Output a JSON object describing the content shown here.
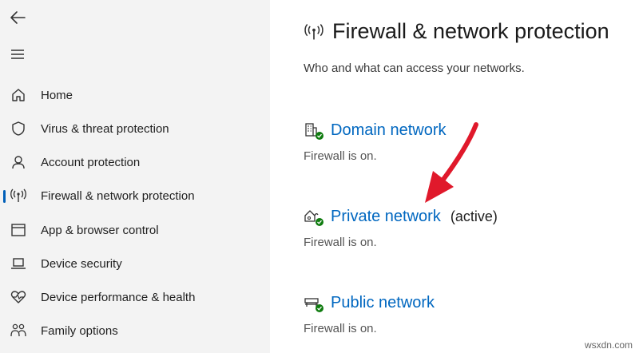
{
  "sidebar": {
    "back_icon": "back-arrow-icon",
    "menu_icon": "hamburger-menu-icon",
    "items": [
      {
        "label": "Home",
        "icon": "home-icon"
      },
      {
        "label": "Virus & threat protection",
        "icon": "shield-icon"
      },
      {
        "label": "Account protection",
        "icon": "person-icon"
      },
      {
        "label": "Firewall & network protection",
        "icon": "antenna-icon",
        "active": true
      },
      {
        "label": "App & browser control",
        "icon": "browser-window-icon"
      },
      {
        "label": "Device security",
        "icon": "laptop-icon"
      },
      {
        "label": "Device performance & health",
        "icon": "heart-pulse-icon"
      },
      {
        "label": "Family options",
        "icon": "family-icon"
      }
    ]
  },
  "main": {
    "title": "Firewall & network protection",
    "subtitle": "Who and what can access your networks.",
    "networks": [
      {
        "name": "Domain network",
        "extra": "",
        "status": "Firewall is on.",
        "icon": "building-icon"
      },
      {
        "name": "Private network",
        "extra": "(active)",
        "status": "Firewall is on.",
        "icon": "house-icon"
      },
      {
        "name": "Public network",
        "extra": "",
        "status": "Firewall is on.",
        "icon": "bench-icon"
      }
    ]
  },
  "colors": {
    "accent": "#0067c0",
    "check": "#0f7b0f",
    "arrow": "#e0192b",
    "sidebar_bg": "#f3f3f3"
  },
  "watermark": "wsxdn.com"
}
